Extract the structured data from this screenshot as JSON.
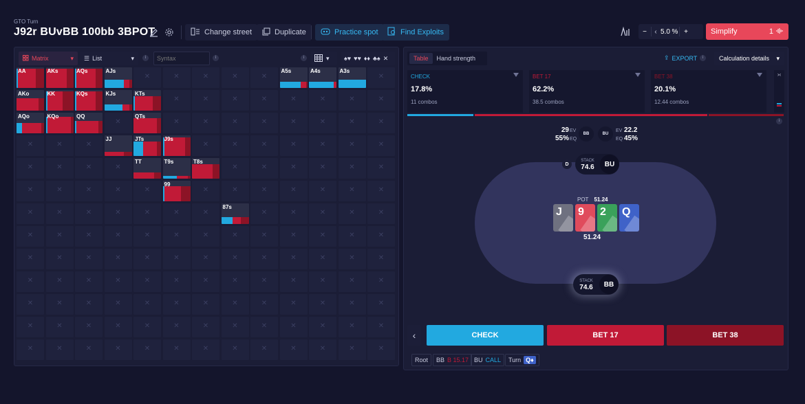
{
  "header": {
    "breadcrumb": "GTO Turn",
    "title": "J92r BUvBB 100bb 3BPOT",
    "change_street": "Change street",
    "duplicate": "Duplicate",
    "practice_spot": "Practice spot",
    "find_exploits": "Find Exploits",
    "step_value": "5.0",
    "step_unit": "%",
    "simplify": "Simplify",
    "simplify_level": "1",
    "minus": "−",
    "plus": "+",
    "chev_left": "‹"
  },
  "left_toolbar": {
    "view_matrix": "Matrix",
    "view_list": "List",
    "syntax_placeholder": "Syntax",
    "info": "i",
    "close": "✕"
  },
  "matrix": {
    "ranks": [
      "A",
      "K",
      "Q",
      "J",
      "T",
      "9",
      "8",
      "7",
      "6",
      "5",
      "4",
      "3",
      "2"
    ],
    "hands": {
      "0-0": {
        "label": "AA",
        "check": 0.05,
        "bet17": 0.65,
        "bet38": 0.3,
        "h": 0.95
      },
      "0-1": {
        "label": "AKs",
        "check": 0.0,
        "bet17": 0.75,
        "bet38": 0.25,
        "h": 0.95
      },
      "0-2": {
        "label": "AQs",
        "check": 0.05,
        "bet17": 0.7,
        "bet38": 0.25,
        "h": 0.95
      },
      "0-3": {
        "label": "AJs",
        "check": 0.7,
        "bet17": 0.2,
        "bet38": 0.1,
        "h": 0.4
      },
      "0-9": {
        "label": "A5s",
        "check": 0.75,
        "bet17": 0.2,
        "bet38": 0.05,
        "h": 0.3
      },
      "0-10": {
        "label": "A4s",
        "check": 0.9,
        "bet17": 0.1,
        "bet38": 0.0,
        "h": 0.3
      },
      "0-11": {
        "label": "A3s",
        "check": 1.0,
        "bet17": 0.0,
        "bet38": 0.0,
        "h": 0.4
      },
      "1-0": {
        "label": "AKo",
        "check": 0.0,
        "bet17": 0.8,
        "bet38": 0.2,
        "h": 0.6
      },
      "1-1": {
        "label": "KK",
        "check": 0.05,
        "bet17": 0.55,
        "bet38": 0.4,
        "h": 0.95
      },
      "1-2": {
        "label": "KQs",
        "check": 0.05,
        "bet17": 0.7,
        "bet38": 0.25,
        "h": 0.95
      },
      "1-3": {
        "label": "KJs",
        "check": 0.65,
        "bet17": 0.25,
        "bet38": 0.1,
        "h": 0.3
      },
      "1-4": {
        "label": "KTs",
        "check": 0.05,
        "bet17": 0.65,
        "bet38": 0.3,
        "h": 0.7
      },
      "2-0": {
        "label": "AQo",
        "check": 0.2,
        "bet17": 0.7,
        "bet38": 0.1,
        "h": 0.5
      },
      "2-1": {
        "label": "KQo",
        "check": 0.05,
        "bet17": 0.85,
        "bet38": 0.1,
        "h": 0.8
      },
      "2-2": {
        "label": "QQ",
        "check": 0.05,
        "bet17": 0.8,
        "bet38": 0.15,
        "h": 0.6
      },
      "2-4": {
        "label": "QTs",
        "check": 0.0,
        "bet17": 0.85,
        "bet38": 0.15,
        "h": 0.75
      },
      "3-3": {
        "label": "JJ",
        "check": 0.0,
        "bet17": 0.7,
        "bet38": 0.3,
        "h": 0.2
      },
      "3-4": {
        "label": "JTs",
        "check": 0.35,
        "bet17": 0.5,
        "bet38": 0.15,
        "h": 0.7
      },
      "3-5": {
        "label": "J9s",
        "check": 0.05,
        "bet17": 0.75,
        "bet38": 0.2,
        "h": 0.9
      },
      "4-4": {
        "label": "TT",
        "check": 0.0,
        "bet17": 0.75,
        "bet38": 0.25,
        "h": 0.3
      },
      "4-5": {
        "label": "T9s",
        "check": 0.5,
        "bet17": 0.4,
        "bet38": 0.1,
        "h": 0.15
      },
      "4-6": {
        "label": "T8s",
        "check": 0.0,
        "bet17": 0.75,
        "bet38": 0.25,
        "h": 0.7
      },
      "5-5": {
        "label": "99",
        "check": 0.05,
        "bet17": 0.6,
        "bet38": 0.35,
        "h": 0.75
      },
      "6-7": {
        "label": "87s",
        "check": 0.4,
        "bet17": 0.3,
        "bet38": 0.3,
        "h": 0.35
      }
    }
  },
  "right_tabs": {
    "table": "Table",
    "hand_strength": "Hand strength",
    "export": "EXPORT",
    "calc_details": "Calculation details"
  },
  "actions": [
    {
      "name": "CHECK",
      "pct": "17.8%",
      "combos": "11 combos",
      "color": "#22a9e0"
    },
    {
      "name": "BET 17",
      "pct": "62.2%",
      "combos": "38.5 combos",
      "color": "#c11a37"
    },
    {
      "name": "BET 38",
      "pct": "20.1%",
      "combos": "12.44 combos",
      "color": "#8c1326"
    }
  ],
  "frequency_bar": [
    0.178,
    0.622,
    0.201
  ],
  "expand_toggle": "›‹",
  "table": {
    "bb_ev": "29",
    "bb_eq": "55%",
    "bu_ev": "22.2",
    "bu_eq": "45%",
    "ev_label": "EV",
    "eq_label": "EQ",
    "bb": "BB",
    "bu": "BU",
    "dealer": "D",
    "stack_label": "STACK",
    "top_stack": "74.6",
    "top_player": "BU",
    "bottom_stack": "74.6",
    "bottom_player": "BB",
    "pot_label": "POT",
    "pot_value": "51.24",
    "pot_total": "51.24",
    "board": [
      {
        "rank": "J",
        "color": "#6f7180"
      },
      {
        "rank": "9",
        "color": "#e04b5c"
      },
      {
        "rank": "2",
        "color": "#3aa15a"
      },
      {
        "rank": "Q",
        "color": "#3f62c8"
      }
    ]
  },
  "buttons": {
    "back": "‹",
    "check": "CHECK",
    "bet17": "BET 17",
    "bet38": "BET 38"
  },
  "history": {
    "root": "Root",
    "bb": "BB",
    "bb_action": "B 15.17",
    "bu": "BU",
    "bu_action": "CALL",
    "turn": "Turn",
    "turn_card": "Q♦"
  }
}
